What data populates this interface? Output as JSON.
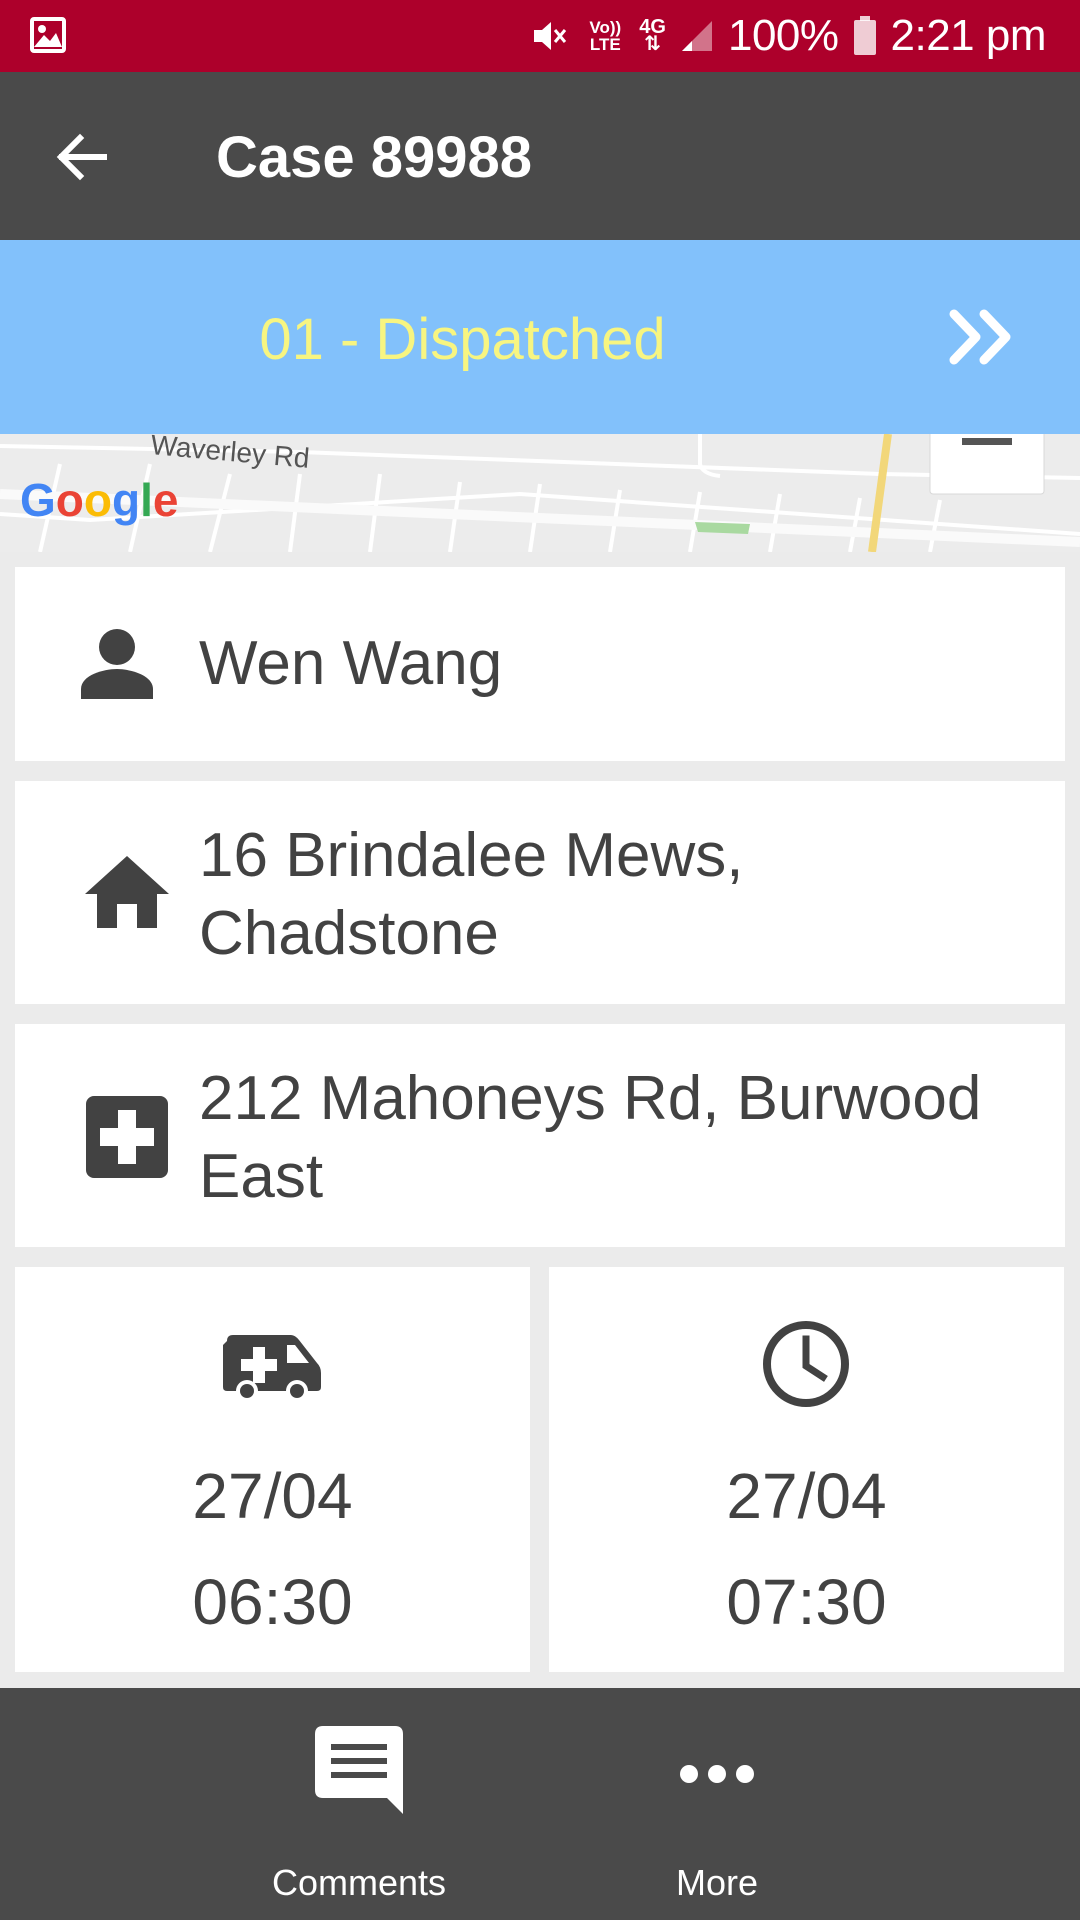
{
  "status_bar": {
    "battery": "100%",
    "time": "2:21 pm",
    "volte": "Vo)) LTE",
    "network": "4G"
  },
  "app_bar": {
    "title": "Case 89988"
  },
  "status_banner": {
    "label": "01 - Dispatched",
    "text_color": "#f7f581",
    "background": "#82c1fb"
  },
  "map": {
    "road_label": "Waverley Rd",
    "attribution": "Google"
  },
  "patient": {
    "name": "Wen Wang",
    "icon": "person-icon"
  },
  "pickup": {
    "address": "16 Brindalee Mews, Chadstone",
    "icon": "home-icon"
  },
  "destination": {
    "address": "212 Mahoneys Rd, Burwood East",
    "icon": "medical-cross-icon"
  },
  "times": {
    "dispatch": {
      "date": "27/04",
      "time": "06:30",
      "icon": "ambulance-icon"
    },
    "appointment": {
      "date": "27/04",
      "time": "07:30",
      "icon": "clock-icon"
    }
  },
  "bottom_nav": {
    "comments_label": "Comments",
    "more_label": "More"
  },
  "colors": {
    "status_bar": "#ad002b",
    "app_bar": "#4a4a4a",
    "background": "#ebebeb"
  }
}
